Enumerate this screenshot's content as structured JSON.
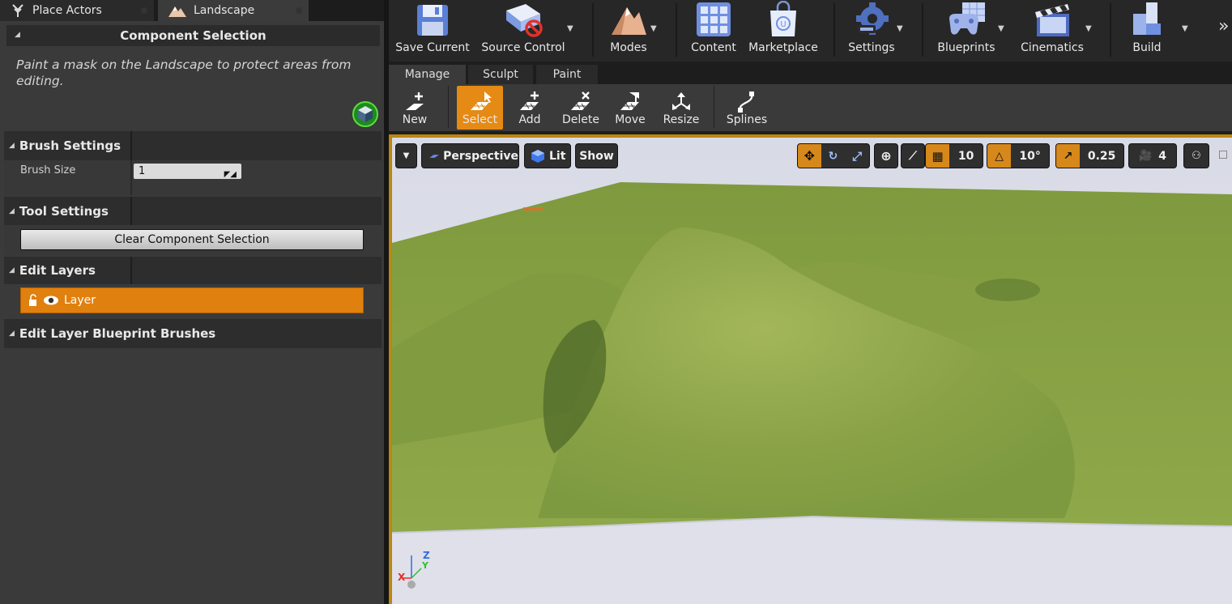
{
  "tabs": [
    {
      "label": "Place Actors"
    },
    {
      "label": "Landscape"
    }
  ],
  "panel": {
    "component_selection": {
      "title": "Component Selection",
      "description": "Paint a mask on the Landscape to protect areas from editing."
    },
    "brush_settings": {
      "title": "Brush Settings",
      "brush_size_label": "Brush Size",
      "brush_size_value": "1"
    },
    "tool_settings": {
      "title": "Tool Settings",
      "clear_button": "Clear Component Selection"
    },
    "edit_layers": {
      "title": "Edit Layers",
      "layer_name": "Layer"
    },
    "edit_bp_brushes": {
      "title": "Edit Layer Blueprint Brushes"
    }
  },
  "toolbar": {
    "save_current": "Save Current",
    "source_control": "Source Control",
    "modes": "Modes",
    "content": "Content",
    "marketplace": "Marketplace",
    "settings": "Settings",
    "blueprints": "Blueprints",
    "cinematics": "Cinematics",
    "build": "Build"
  },
  "mode_tabs": {
    "manage": "Manage",
    "sculpt": "Sculpt",
    "paint": "Paint"
  },
  "sub_tools": {
    "new": "New",
    "select": "Select",
    "add": "Add",
    "delete": "Delete",
    "move": "Move",
    "resize": "Resize",
    "splines": "Splines"
  },
  "viewport": {
    "perspective": "Perspective",
    "lit": "Lit",
    "show": "Show",
    "grid_snap": "10",
    "rotation_snap": "10°",
    "scale_snap": "0.25",
    "camera_speed": "4"
  },
  "colors": {
    "accent": "#e0800f",
    "panel_bg": "#3a3a3a",
    "grass": "#8ba445"
  }
}
